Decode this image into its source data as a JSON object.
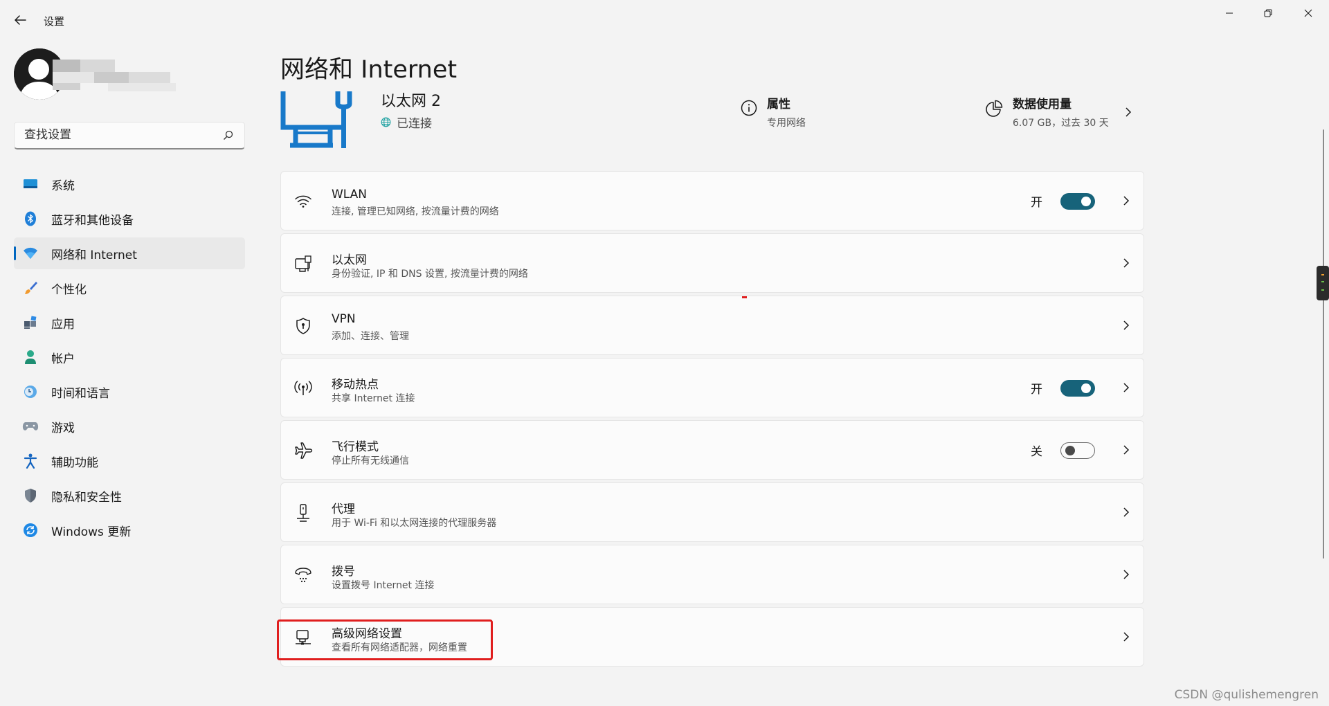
{
  "app": {
    "title": "设置"
  },
  "search": {
    "placeholder": "查找设置"
  },
  "sidebar": {
    "items": [
      {
        "label": "系统",
        "icon": "monitor-icon"
      },
      {
        "label": "蓝牙和其他设备",
        "icon": "bluetooth-icon"
      },
      {
        "label": "网络和 Internet",
        "icon": "wifi-icon",
        "active": true
      },
      {
        "label": "个性化",
        "icon": "brush-icon"
      },
      {
        "label": "应用",
        "icon": "apps-icon"
      },
      {
        "label": "帐户",
        "icon": "person-icon"
      },
      {
        "label": "时间和语言",
        "icon": "clock-globe-icon"
      },
      {
        "label": "游戏",
        "icon": "gamepad-icon"
      },
      {
        "label": "辅助功能",
        "icon": "accessibility-icon"
      },
      {
        "label": "隐私和安全性",
        "icon": "shield-icon"
      },
      {
        "label": "Windows 更新",
        "icon": "update-icon"
      }
    ]
  },
  "main": {
    "title": "网络和 Internet",
    "connection": {
      "name": "以太网 2",
      "status": "已连接",
      "properties": {
        "title": "属性",
        "subtitle": "专用网络"
      },
      "data_usage": {
        "title": "数据使用量",
        "subtitle": "6.07 GB，过去 30 天"
      }
    },
    "cards": [
      {
        "title": "WLAN",
        "subtitle": "连接, 管理已知网络, 按流量计费的网络",
        "icon": "wifi-icon",
        "toggle": {
          "label": "开",
          "on": true
        }
      },
      {
        "title": "以太网",
        "subtitle": "身份验证, IP 和 DNS 设置, 按流量计费的网络",
        "icon": "ethernet-icon"
      },
      {
        "title": "VPN",
        "subtitle": "添加、连接、管理",
        "icon": "vpn-shield-icon"
      },
      {
        "title": "移动热点",
        "subtitle": "共享 Internet 连接",
        "icon": "hotspot-icon",
        "toggle": {
          "label": "开",
          "on": true
        }
      },
      {
        "title": "飞行模式",
        "subtitle": "停止所有无线通信",
        "icon": "airplane-icon",
        "toggle": {
          "label": "关",
          "on": false
        }
      },
      {
        "title": "代理",
        "subtitle": "用于 Wi-Fi 和以太网连接的代理服务器",
        "icon": "proxy-icon"
      },
      {
        "title": "拨号",
        "subtitle": "设置拨号 Internet 连接",
        "icon": "dialup-icon"
      },
      {
        "title": "高级网络设置",
        "subtitle": "查看所有网络适配器，网络重置",
        "icon": "advanced-network-icon"
      }
    ]
  },
  "colors": {
    "accent": "#0067c0",
    "toggle_on": "#17637a",
    "highlight": "#e01e1e"
  },
  "watermark": "CSDN @qulishemengren"
}
